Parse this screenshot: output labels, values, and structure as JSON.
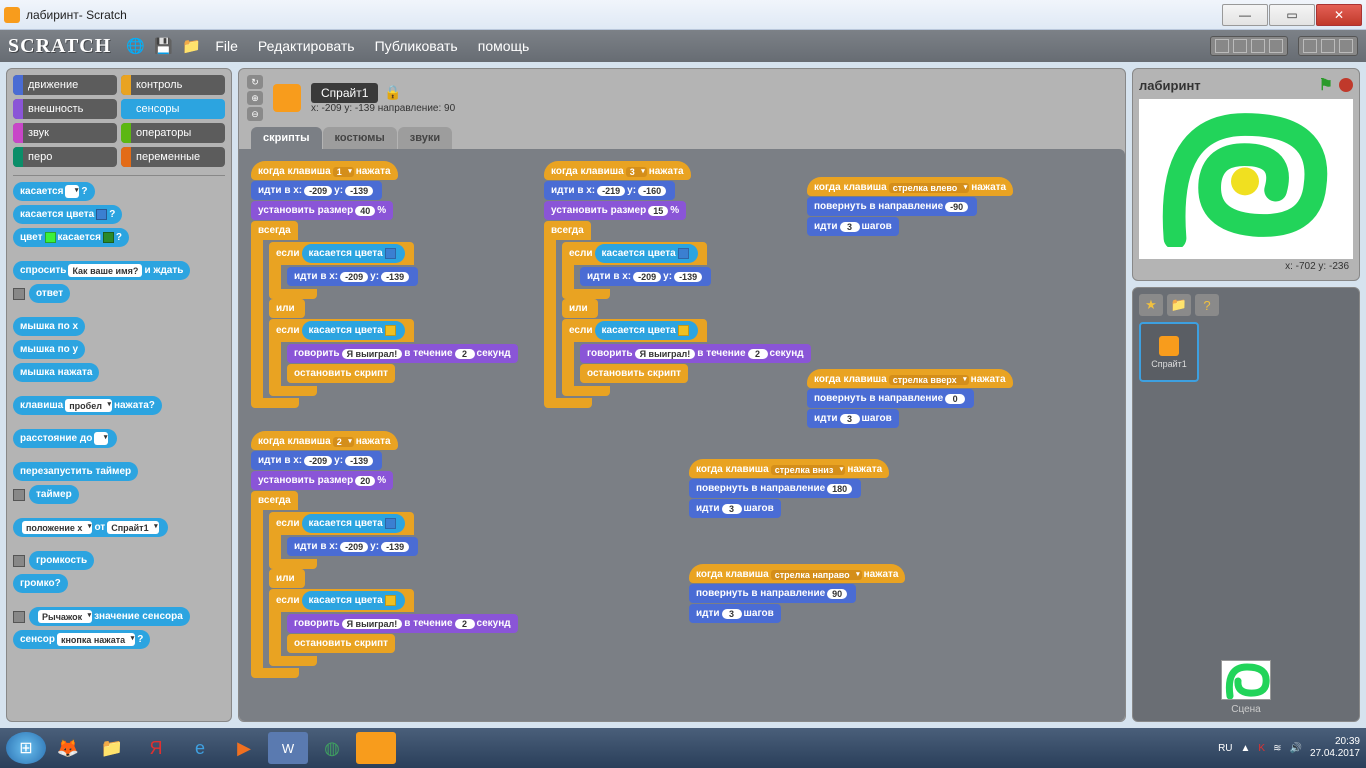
{
  "window": {
    "title": "лабиринт- Scratch"
  },
  "toolbar": {
    "logo": "SCRATCH",
    "menus": [
      "File",
      "Редактировать",
      "Публиковать",
      "помощь"
    ]
  },
  "categories": [
    {
      "label": "движение",
      "color": "#4a6cd4"
    },
    {
      "label": "контроль",
      "color": "#e9a322"
    },
    {
      "label": "внешность",
      "color": "#8a55d7"
    },
    {
      "label": "сенсоры",
      "color": "#2ca4e0"
    },
    {
      "label": "звук",
      "color": "#c846c8"
    },
    {
      "label": "операторы",
      "color": "#5cb712"
    },
    {
      "label": "перо",
      "color": "#0b8e69"
    },
    {
      "label": "переменные",
      "color": "#e36b17"
    }
  ],
  "palette": {
    "touching": "касается",
    "touching_dd": " ",
    "touching_color": "касается цвета",
    "color_touches": "цвет",
    "touches": "касается",
    "ask": "спросить",
    "ask_default": "Как ваше имя?",
    "and_wait": "и ждать",
    "answer": "ответ",
    "mousex": "мышка по x",
    "mousey": "мышка по y",
    "mousedown": "мышка нажата",
    "key": "клавиша",
    "space": "пробел",
    "pressed": "нажата?",
    "distance": "расстояние до",
    "reset_timer": "перезапустить таймер",
    "timer": "таймер",
    "position": "положение x",
    "of": "от",
    "sprite": "Спрайт1",
    "loudness": "громкость",
    "loud": "громко?",
    "lever": "Рычажок",
    "sensor_value": "значение сенсора",
    "sensor": "сенсор",
    "button_pressed": "кнопка нажата"
  },
  "sprite_header": {
    "name": "Спрайт1",
    "coords": "x: -209 y: -139 направление: 90"
  },
  "tabs": [
    "скрипты",
    "костюмы",
    "звуки"
  ],
  "scripts": {
    "when_key": "когда клавиша",
    "pressed": "нажата",
    "goto": "идти в x:",
    "y": "y:",
    "set_size": "установить размер",
    "pct": "%",
    "forever": "всегда",
    "if": "если",
    "touching_color": "касается цвета",
    "or": "или",
    "say": "говорить",
    "won": "Я выиграл!",
    "for": "в течение",
    "seconds": "секунд",
    "stop_script": "остановить скрипт",
    "left_arrow": "стрелка влево",
    "up_arrow": "стрелка вверх",
    "down_arrow": "стрелка вниз",
    "right_arrow": "стрелка направо",
    "point": "повернуть в направление",
    "move": "идти",
    "steps": "шагов",
    "k1": "1",
    "k2": "2",
    "k3": "3",
    "x209": "-209",
    "y139": "-139",
    "x219": "-219",
    "y160": "-160",
    "s40": "40",
    "s15": "15",
    "s20": "20",
    "n2": "2",
    "n3": "3",
    "dn90": "-90",
    "d0": "0",
    "d180": "180",
    "d90": "90"
  },
  "stage": {
    "title": "лабиринт",
    "coord": "x: -702   y: -236",
    "sprite_name": "Спрайт1",
    "scene": "Сцена"
  },
  "taskbar": {
    "lang": "RU",
    "time": "20:39",
    "date": "27.04.2017"
  },
  "colors": {
    "wall": "#3b7fd1",
    "goal": "#f0c020",
    "spiral": "#22d45a"
  }
}
